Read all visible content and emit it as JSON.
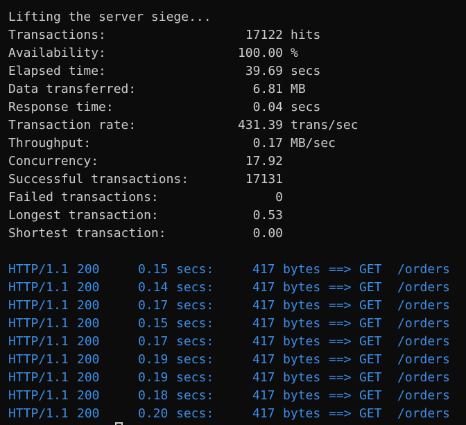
{
  "header": "Lifting the server siege...",
  "stats": [
    {
      "label": "Transactions:",
      "value": "17122",
      "unit": "hits"
    },
    {
      "label": "Availability:",
      "value": "100.00",
      "unit": "%"
    },
    {
      "label": "Elapsed time:",
      "value": "39.69",
      "unit": "secs"
    },
    {
      "label": "Data transferred:",
      "value": "6.81",
      "unit": "MB"
    },
    {
      "label": "Response time:",
      "value": "0.04",
      "unit": "secs"
    },
    {
      "label": "Transaction rate:",
      "value": "431.39",
      "unit": "trans/sec"
    },
    {
      "label": "Throughput:",
      "value": "0.17",
      "unit": "MB/sec"
    },
    {
      "label": "Concurrency:",
      "value": "17.92",
      "unit": ""
    },
    {
      "label": "Successful transactions:",
      "value": "17131",
      "unit": ""
    },
    {
      "label": "Failed transactions:",
      "value": "0",
      "unit": ""
    },
    {
      "label": "Longest transaction:",
      "value": "0.53",
      "unit": ""
    },
    {
      "label": "Shortest transaction:",
      "value": "0.00",
      "unit": ""
    }
  ],
  "log": [
    {
      "proto": "HTTP/1.1",
      "status": "200",
      "time": "0.15",
      "time_unit": "secs:",
      "size": "417",
      "size_unit": "bytes",
      "arrow": "==>",
      "method": "GET",
      "path": "/orders"
    },
    {
      "proto": "HTTP/1.1",
      "status": "200",
      "time": "0.14",
      "time_unit": "secs:",
      "size": "417",
      "size_unit": "bytes",
      "arrow": "==>",
      "method": "GET",
      "path": "/orders"
    },
    {
      "proto": "HTTP/1.1",
      "status": "200",
      "time": "0.17",
      "time_unit": "secs:",
      "size": "417",
      "size_unit": "bytes",
      "arrow": "==>",
      "method": "GET",
      "path": "/orders"
    },
    {
      "proto": "HTTP/1.1",
      "status": "200",
      "time": "0.15",
      "time_unit": "secs:",
      "size": "417",
      "size_unit": "bytes",
      "arrow": "==>",
      "method": "GET",
      "path": "/orders"
    },
    {
      "proto": "HTTP/1.1",
      "status": "200",
      "time": "0.17",
      "time_unit": "secs:",
      "size": "417",
      "size_unit": "bytes",
      "arrow": "==>",
      "method": "GET",
      "path": "/orders"
    },
    {
      "proto": "HTTP/1.1",
      "status": "200",
      "time": "0.19",
      "time_unit": "secs:",
      "size": "417",
      "size_unit": "bytes",
      "arrow": "==>",
      "method": "GET",
      "path": "/orders"
    },
    {
      "proto": "HTTP/1.1",
      "status": "200",
      "time": "0.19",
      "time_unit": "secs:",
      "size": "417",
      "size_unit": "bytes",
      "arrow": "==>",
      "method": "GET",
      "path": "/orders"
    },
    {
      "proto": "HTTP/1.1",
      "status": "200",
      "time": "0.18",
      "time_unit": "secs:",
      "size": "417",
      "size_unit": "bytes",
      "arrow": "==>",
      "method": "GET",
      "path": "/orders"
    },
    {
      "proto": "HTTP/1.1",
      "status": "200",
      "time": "0.20",
      "time_unit": "secs:",
      "size": "417",
      "size_unit": "bytes",
      "arrow": "==>",
      "method": "GET",
      "path": "/orders"
    }
  ],
  "colors": {
    "background": "#0c0c0c",
    "text": "#cccccc",
    "log_text": "#3b8eea"
  }
}
